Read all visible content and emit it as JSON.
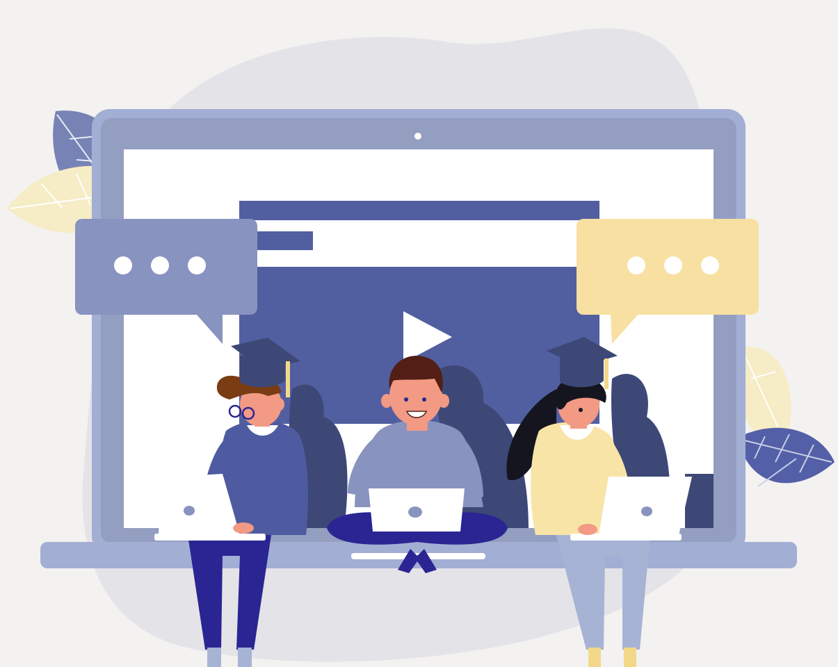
{
  "scene": {
    "colors": {
      "background": "#f3f2f1",
      "blob": "#e4e3e8",
      "laptop_body": "#a3aed5",
      "laptop_bezel": "#939ec0",
      "screen": "#ffffff",
      "video_player": "#515fa1",
      "bubble_blue": "#8893bf",
      "bubble_yellow": "#f7e0a2",
      "navy": "#2a2592",
      "cap": "#3d4876",
      "tassel": "#f3d88a",
      "skin": "#f29a84",
      "hair_brown": "#7a3c12",
      "hair_dark": "#521e16",
      "hair_black": "#15151f",
      "sweater_blue": "#4f5ba0",
      "shirt_gray": "#8893bf",
      "sweater_yellow": "#f8e4a7",
      "pants_light": "#a7b3d4",
      "leaf_blue": "#535fa6",
      "leaf_slate": "#7883b5",
      "leaf_cream": "#f6ecc5",
      "shadow": "#3d4876"
    },
    "icons": {
      "play": "play-icon",
      "chat_left": "chat-bubble-icon",
      "chat_right": "chat-bubble-icon"
    }
  }
}
